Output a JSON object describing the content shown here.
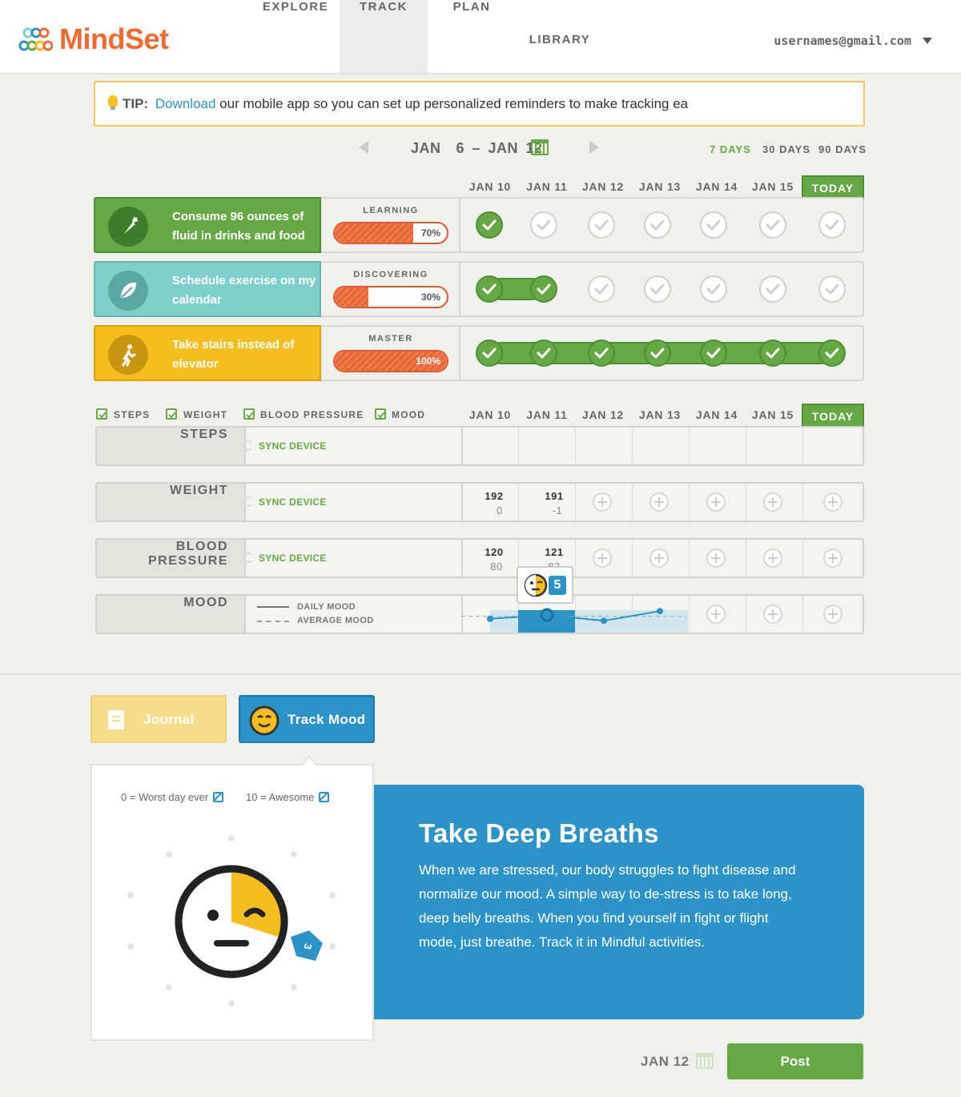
{
  "header": {
    "brand": "MindSet",
    "nav": [
      "EXPLORE",
      "TRACK",
      "PLAN",
      "LIBRARY"
    ],
    "active_nav": "TRACK",
    "user_email": "usernames@gmail.com"
  },
  "tip": {
    "label": "TIP:",
    "link": "Download",
    "text": " our mobile app so you can set up personalized reminders to make tracking ea"
  },
  "date_nav": {
    "range": "JAN  6 – JAN 12",
    "ranges": [
      "7 DAYS",
      "30 DAYS",
      "90 DAYS"
    ],
    "active_range": "7 DAYS"
  },
  "columns": [
    "JAN 10",
    "JAN 11",
    "JAN 12",
    "JAN 13",
    "JAN 14",
    "JAN 15",
    "TODAY"
  ],
  "habits": [
    {
      "title": "Consume 96 ounces of fluid in drinks and food",
      "stage": "LEARNING",
      "progress": "70%",
      "progress_value": 0.7,
      "color": "#65a844",
      "icon": "carrot-icon",
      "done": [
        true,
        false,
        false,
        false,
        false,
        false,
        false
      ]
    },
    {
      "title": "Schedule exercise on my calendar",
      "stage": "DISCOVERING",
      "progress": "30%",
      "progress_value": 0.3,
      "color": "#7fcfcc",
      "icon": "leaf-icon",
      "done": [
        true,
        true,
        false,
        false,
        false,
        false,
        false
      ]
    },
    {
      "title": "Take stairs instead of elevator",
      "stage": "MASTER",
      "progress": "100%",
      "progress_value": 1.0,
      "color": "#f6bd1e",
      "icon": "walking-person-icon",
      "done": [
        true,
        true,
        true,
        true,
        true,
        true,
        true
      ]
    }
  ],
  "metric_toggles": [
    "STEPS",
    "WEIGHT",
    "BLOOD PRESSURE",
    "MOOD"
  ],
  "metrics": {
    "steps": {
      "label": "STEPS",
      "action": "SYNC DEVICE"
    },
    "weight": {
      "label": "WEIGHT",
      "action": "SYNC DEVICE",
      "values": [
        {
          "main": "192",
          "sub": "0"
        },
        {
          "main": "191",
          "sub": "-1"
        }
      ]
    },
    "blood_pressure": {
      "label": "BLOOD PRESSURE",
      "action": "SYNC DEVICE",
      "values": [
        {
          "main": "120",
          "sub": "80"
        },
        {
          "main": "121",
          "sub": "82"
        }
      ]
    },
    "mood": {
      "label": "MOOD",
      "legend_daily": "DAILY MOOD",
      "legend_average": "AVERAGE MOOD",
      "tooltip_value": "5"
    }
  },
  "mood_chart": {
    "daily": [
      3.8,
      5,
      3.2,
      6.2
    ],
    "average": 4.6,
    "ylim": [
      0,
      10
    ]
  },
  "actions": {
    "journal": "Journal",
    "track_mood": "Track Mood"
  },
  "mood_scale": {
    "min_label": "0 = Worst day ever",
    "max_label": "10 = Awesome",
    "current_value": "3",
    "current_level": 0.3
  },
  "article": {
    "title": "Take Deep Breaths",
    "body": "When we are stressed, our body struggles to fight disease and normalize our mood. A simple way to de-stress is to take long, deep belly breaths. When you find yourself in fight or flight mode, just breathe. Track it in Mindful activities."
  },
  "footer": {
    "date": "JAN 12",
    "post": "Post"
  },
  "colors": {
    "green": "#65a844",
    "blue": "#2b93c8",
    "orange": "#ef6b2f",
    "yellow": "#f6bd1e",
    "teal": "#7fcfcc"
  }
}
